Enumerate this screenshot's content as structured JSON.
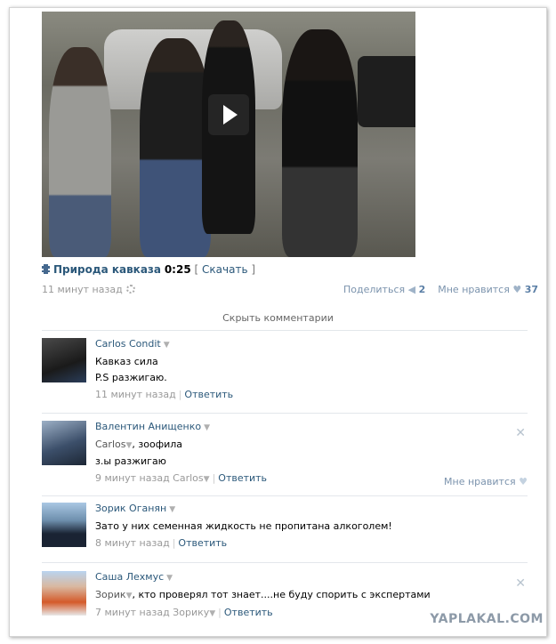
{
  "video": {
    "title": "Природа кавказа",
    "duration": "0:25",
    "download_label": "Скачать",
    "time_ago": "11 минут назад",
    "share_label": "Поделиться",
    "share_count": "2",
    "like_label": "Мне нравится",
    "like_count": "37"
  },
  "hide_comments_label": "Скрыть комментарии",
  "comments": [
    {
      "name": "Carlos Condit",
      "lines": [
        "Кавказ сила",
        "P.S разжигаю."
      ],
      "time": "11 минут назад",
      "reply_label": "Ответить"
    },
    {
      "name": "Валентин Анищенко",
      "reply_to": "Carlos",
      "line1_rest": ", зоофила",
      "line2": "з.ы разжигаю",
      "time": "9 минут назад Carlos",
      "reply_label": "Ответить",
      "like_label": "Мне нравится"
    },
    {
      "name": "Зорик Оганян",
      "lines": [
        "Зато у них семенная жидкость не пропитана алкоголем!"
      ],
      "time": "8 минут назад",
      "reply_label": "Ответить"
    },
    {
      "name": "Саша Лехмус",
      "reply_to": "Зорик",
      "line1_rest": ", кто проверял тот знает....не буду спорить с экспертами",
      "time": "7 минут назад Зорику",
      "reply_label": "Ответить"
    }
  ],
  "watermark": "YAPLAKAL.COM",
  "icons": {
    "film": "film-icon",
    "gear": "gear-icon",
    "megaphone": "megaphone-icon",
    "heart": "heart-icon",
    "close": "close-icon",
    "dropdown": "dropdown-arrow-icon",
    "play": "play-icon"
  }
}
